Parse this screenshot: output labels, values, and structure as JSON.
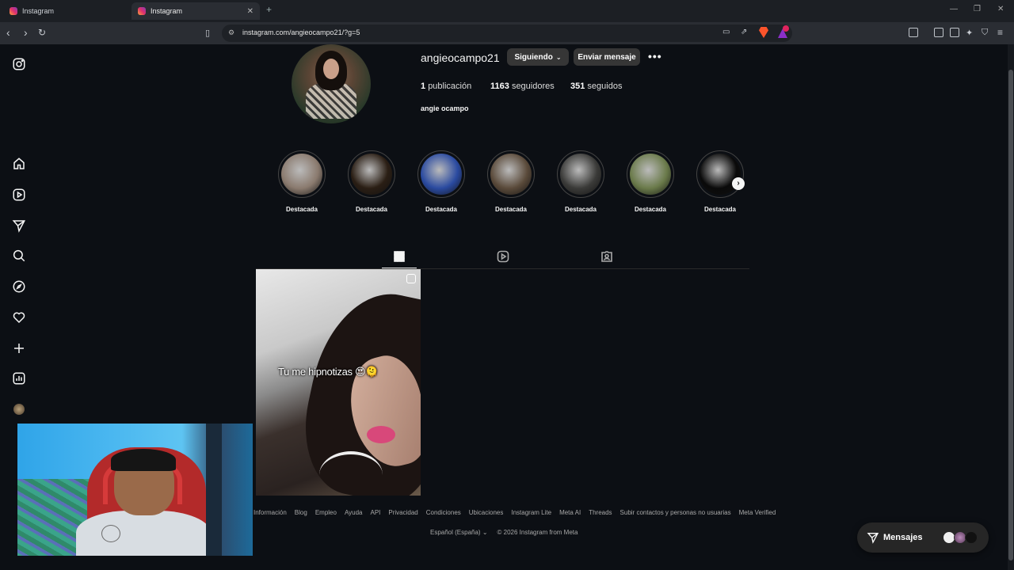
{
  "browser": {
    "tabs": [
      {
        "title": "Instagram",
        "active": false
      },
      {
        "title": "Instagram",
        "active": true
      }
    ],
    "url": "instagram.com/angieocampo21/?g=5"
  },
  "profile": {
    "username": "angieocampo21",
    "follow_button": "Siguiendo",
    "message_button": "Enviar mensaje",
    "more_label": "•••",
    "posts_count": "1",
    "posts_label": "publicación",
    "followers_count": "1163",
    "followers_label": "seguidores",
    "following_count": "351",
    "following_label": "seguidos",
    "full_name": "angie ocampo"
  },
  "highlights": [
    {
      "label": "Destacada",
      "color": "#8a7a6e"
    },
    {
      "label": "Destacada",
      "color": "#2a1e14"
    },
    {
      "label": "Destacada",
      "color": "#2a4aa0"
    },
    {
      "label": "Destacada",
      "color": "#5a4a3a"
    },
    {
      "label": "Destacada",
      "color": "#3a3a38"
    },
    {
      "label": "Destacada",
      "color": "#6a7a4a"
    },
    {
      "label": "Destacada",
      "color": "#0a0a0a"
    }
  ],
  "post": {
    "caption": "Tu me hipnotizas 😍🫠"
  },
  "footer": {
    "links": [
      "Información",
      "Blog",
      "Empleo",
      "Ayuda",
      "API",
      "Privacidad",
      "Condiciones",
      "Ubicaciones",
      "Instagram Lite",
      "Meta AI",
      "Threads",
      "Subir contactos y personas no usuarias",
      "Meta Verified"
    ],
    "language": "Español (España)",
    "copyright": "© 2026 Instagram from Meta"
  },
  "messages": {
    "label": "Mensajes"
  },
  "colors": {
    "background": "#0c0f14",
    "button": "#363636",
    "brave": "#fb542b"
  }
}
